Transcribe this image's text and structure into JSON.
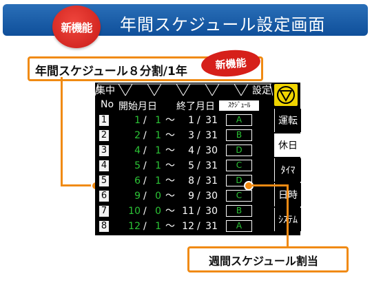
{
  "header": {
    "badge": "新機能",
    "title": "年間スケジュール設定画面"
  },
  "callout_top": {
    "text": "年間スケジュール８分割/1年",
    "badge": "新機能"
  },
  "callout_bottom": {
    "text": "週間スケジュール割当"
  },
  "screen": {
    "topbar": {
      "left": "集中",
      "right": "設定"
    },
    "columns": {
      "no": "No",
      "start": "開始月日",
      "end": "終了月日",
      "schedule": "ｽｹｼﾞｭｰﾙ"
    },
    "tilde": "～",
    "rows": [
      {
        "no": "1",
        "sm": "1",
        "sd": "1",
        "em": "1",
        "ed": "31",
        "sched": "A"
      },
      {
        "no": "2",
        "sm": "2",
        "sd": "1",
        "em": "3",
        "ed": "31",
        "sched": "B"
      },
      {
        "no": "3",
        "sm": "4",
        "sd": "1",
        "em": "4",
        "ed": "30",
        "sched": "D"
      },
      {
        "no": "4",
        "sm": "5",
        "sd": "1",
        "em": "5",
        "ed": "31",
        "sched": "C"
      },
      {
        "no": "5",
        "sm": "6",
        "sd": "1",
        "em": "8",
        "ed": "31",
        "sched": "D"
      },
      {
        "no": "6",
        "sm": "9",
        "sd": "0",
        "em": "9",
        "ed": "30",
        "sched": "C"
      },
      {
        "no": "7",
        "sm": "10",
        "sd": "0",
        "em": "11",
        "ed": "30",
        "sched": "B"
      },
      {
        "no": "8",
        "sm": "12",
        "sd": "1",
        "em": "12",
        "ed": "31",
        "sched": "A"
      }
    ],
    "side_buttons": [
      {
        "label": "運転",
        "active": false
      },
      {
        "label": "休日",
        "active": true
      },
      {
        "label": "ﾀｲﾏ",
        "active": false
      },
      {
        "label": "日時",
        "active": false
      },
      {
        "label": "ｼｽﾃﾑ",
        "active": false
      }
    ],
    "warning_icon": "warning-triangle-icon"
  },
  "colors": {
    "header_blue": "#1a5fab",
    "accent_orange": "#f08a12",
    "badge_red": "#d6201a",
    "lcd_green": "#2cc436",
    "warning_yellow": "#f0d400"
  }
}
